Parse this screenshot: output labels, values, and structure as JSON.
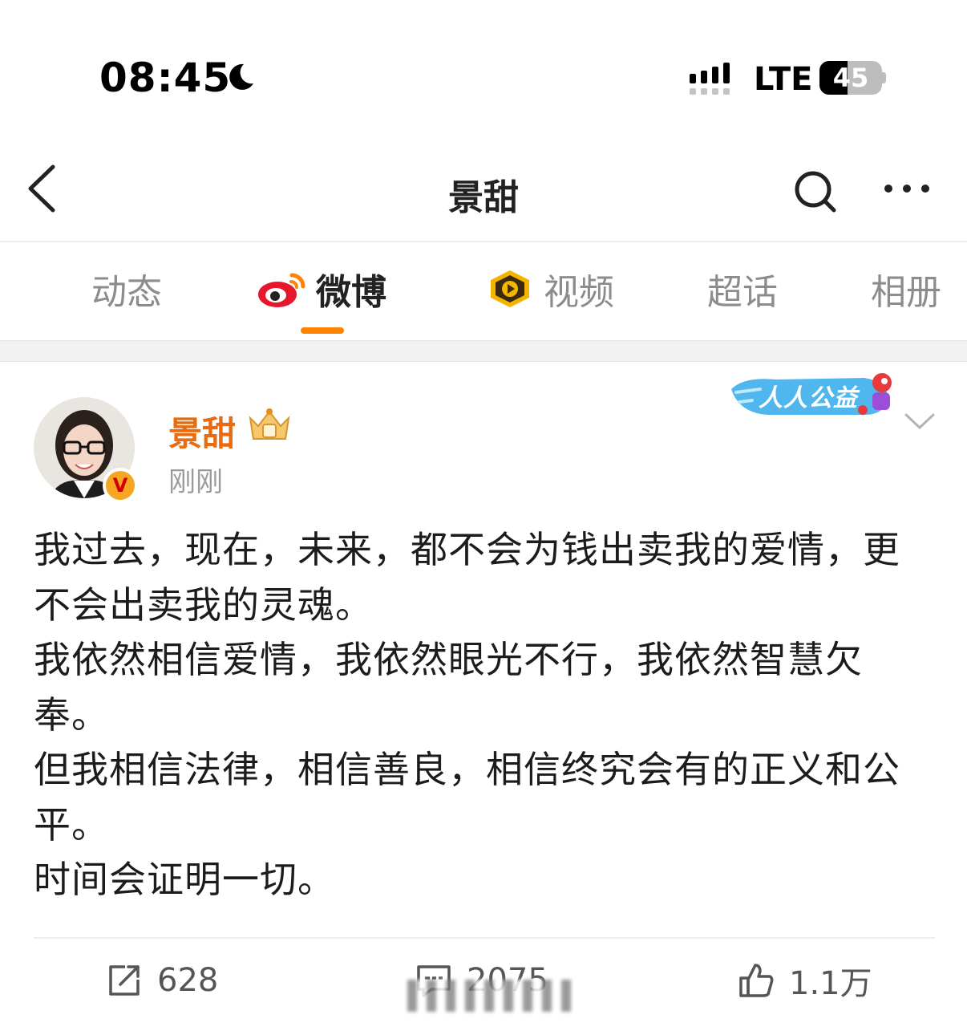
{
  "status_bar": {
    "time": "08:45",
    "network": "LTE",
    "battery": "45",
    "battery_level": 0.45
  },
  "nav": {
    "title": "景甜",
    "icons": [
      "back-icon",
      "search-icon",
      "more-icon"
    ]
  },
  "tabs": [
    {
      "label": "动态",
      "active": false
    },
    {
      "label": "微博",
      "active": true,
      "icon": "weibo-logo-icon"
    },
    {
      "label": "视频",
      "active": false,
      "icon": "video-play-icon"
    },
    {
      "label": "超话",
      "active": false
    },
    {
      "label": "相册",
      "active": false
    }
  ],
  "post": {
    "author": "景甜",
    "time": "刚刚",
    "verified_badge": "V",
    "charity_badge": "人人公益",
    "paragraphs": [
      "我过去，现在，未来，都不会为钱出卖我的爱情，更不会出卖我的灵魂。",
      "我依然相信爱情，我依然眼光不行，我依然智慧欠奉。",
      "但我相信法律，相信善良，相信终究会有的正义和公平。",
      "时间会证明一切。"
    ],
    "actions": {
      "repost": "628",
      "comment": "2075",
      "like": "1.1万"
    }
  },
  "colors": {
    "accent": "#ff8200",
    "author_name": "#e86b0f",
    "muted_text": "#9b9b9b"
  }
}
